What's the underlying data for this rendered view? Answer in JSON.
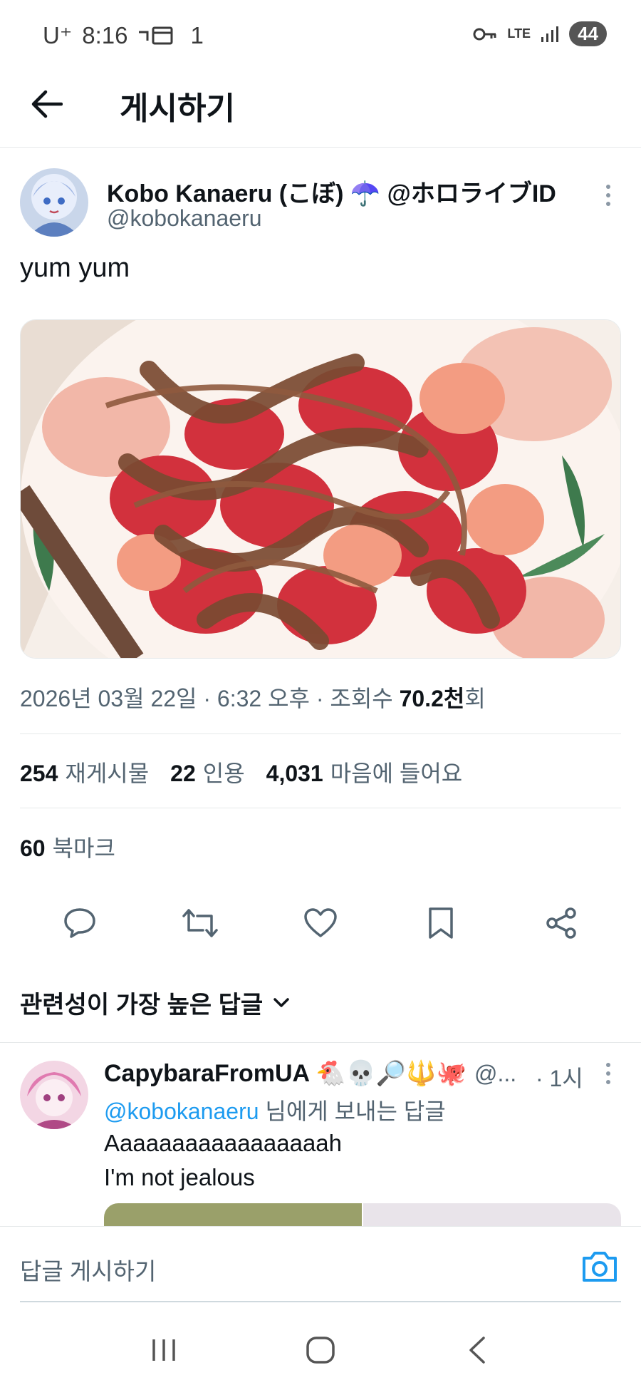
{
  "status_bar": {
    "carrier": "U⁺",
    "time": "8:16",
    "notif_count": "1",
    "network": "LTE",
    "battery": "44"
  },
  "header": {
    "title": "게시하기",
    "back_icon": "arrow-left-icon"
  },
  "tweet": {
    "author_name": "Kobo Kanaeru (こぼ) ☂️ @ホロライブID",
    "author_handle": "@kobokanaeru",
    "text": "yum yum",
    "date": "2026년 03월 22일 · 6:32 오후 · 조회수",
    "views_value": "70.2천",
    "views_suffix": "회",
    "stats": {
      "retweets": "254",
      "retweets_label": "재게시물",
      "quotes": "22",
      "quotes_label": "인용",
      "likes": "4,031",
      "likes_label": "마음에 들어요"
    },
    "bookmarks": "60",
    "bookmarks_label": "북마크"
  },
  "sort_label": "관련성이 가장 높은 답글",
  "reply": {
    "name": "CapybaraFromUA 🐔💀🔎🔱🐙",
    "handle_trunc": "@...",
    "time": "· 1시",
    "replying_mention": "@kobokanaeru",
    "replying_suffix": " 님에게 보내는 답글",
    "line1": "Aaaaaaaaaaaaaaaaah",
    "line2": "I'm not jealous"
  },
  "compose": {
    "placeholder": "답글 게시하기"
  },
  "colors": {
    "accent": "#1d9bf0",
    "secondary_text": "#536471",
    "divider": "#e6e9ea"
  }
}
